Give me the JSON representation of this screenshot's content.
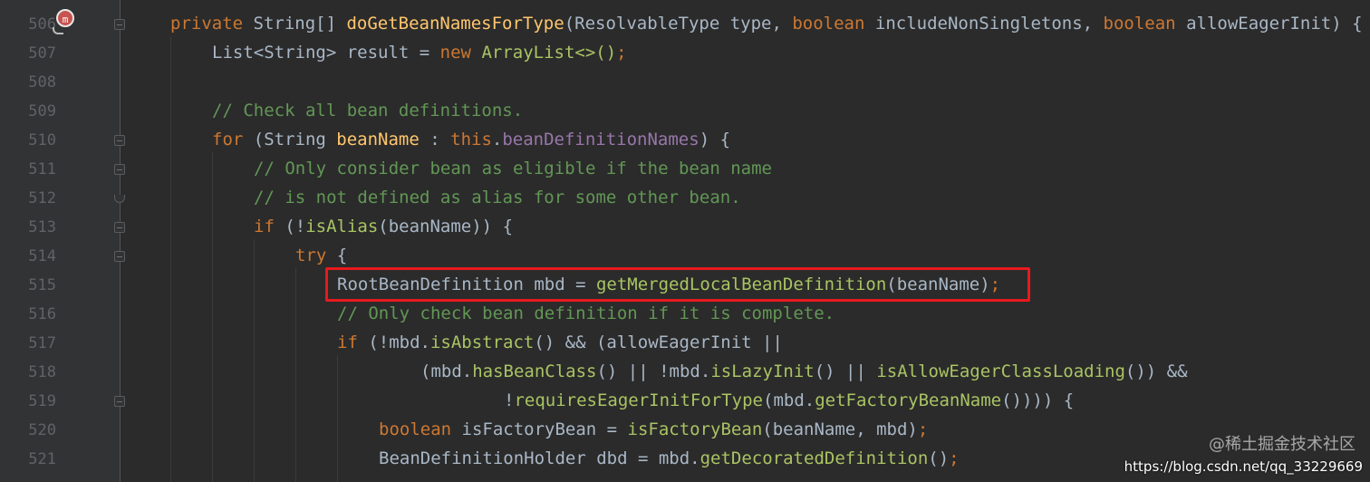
{
  "editor": {
    "lines": [
      {
        "num": "506"
      },
      {
        "num": "507"
      },
      {
        "num": "508"
      },
      {
        "num": "509"
      },
      {
        "num": "510"
      },
      {
        "num": "511"
      },
      {
        "num": "512"
      },
      {
        "num": "513"
      },
      {
        "num": "514"
      },
      {
        "num": "515"
      },
      {
        "num": "516"
      },
      {
        "num": "517"
      },
      {
        "num": "518"
      },
      {
        "num": "519"
      },
      {
        "num": "520"
      },
      {
        "num": "521"
      }
    ],
    "code": {
      "l506": [
        {
          "t": "private ",
          "c": "kw"
        },
        {
          "t": "String[] ",
          "c": "pl"
        },
        {
          "t": "doGetBeanNamesForType",
          "c": "fn"
        },
        {
          "t": "(ResolvableType type, ",
          "c": "pl"
        },
        {
          "t": "boolean ",
          "c": "kw"
        },
        {
          "t": "includeNonSingletons, ",
          "c": "pl"
        },
        {
          "t": "boolean ",
          "c": "kw"
        },
        {
          "t": "allowEagerInit) {",
          "c": "pl"
        }
      ],
      "l507": [
        {
          "t": "List<String> result = ",
          "c": "pl"
        },
        {
          "t": "new ",
          "c": "kw"
        },
        {
          "t": "ArrayList<>()",
          "c": "mc"
        },
        {
          "t": ";",
          "c": "kw"
        }
      ],
      "l508": [],
      "l509": [
        {
          "t": "// Check all bean definitions.",
          "c": "cm"
        }
      ],
      "l510": [
        {
          "t": "for ",
          "c": "kw"
        },
        {
          "t": "(String ",
          "c": "pl"
        },
        {
          "t": "beanName ",
          "c": "fn"
        },
        {
          "t": ": ",
          "c": "pl"
        },
        {
          "t": "this",
          "c": "kw"
        },
        {
          "t": ".",
          "c": "pl"
        },
        {
          "t": "beanDefinitionNames",
          "c": "fld"
        },
        {
          "t": ") {",
          "c": "pl"
        }
      ],
      "l511": [
        {
          "t": "// Only consider bean as eligible if the bean name",
          "c": "cm"
        }
      ],
      "l512": [
        {
          "t": "// is not defined as alias for some other bean.",
          "c": "cm"
        }
      ],
      "l513": [
        {
          "t": "if ",
          "c": "kw"
        },
        {
          "t": "(!",
          "c": "pl"
        },
        {
          "t": "isAlias",
          "c": "mc"
        },
        {
          "t": "(beanName)) {",
          "c": "pl"
        }
      ],
      "l514": [
        {
          "t": "try ",
          "c": "kw"
        },
        {
          "t": "{",
          "c": "pl"
        }
      ],
      "l515": [
        {
          "t": "RootBeanDefinition mbd = ",
          "c": "pl"
        },
        {
          "t": "getMergedLocalBeanDefinition",
          "c": "mc"
        },
        {
          "t": "(beanName)",
          "c": "pl"
        },
        {
          "t": ";",
          "c": "kw"
        }
      ],
      "l516": [
        {
          "t": "// Only check bean definition if it is complete.",
          "c": "cm"
        }
      ],
      "l517": [
        {
          "t": "if ",
          "c": "kw"
        },
        {
          "t": "(!mbd.",
          "c": "pl"
        },
        {
          "t": "isAbstract",
          "c": "mc"
        },
        {
          "t": "() && (allowEagerInit ||",
          "c": "pl"
        }
      ],
      "l518": [
        {
          "t": "(mbd.",
          "c": "pl"
        },
        {
          "t": "hasBeanClass",
          "c": "mc"
        },
        {
          "t": "() || !mbd.",
          "c": "pl"
        },
        {
          "t": "isLazyInit",
          "c": "mc"
        },
        {
          "t": "() || ",
          "c": "pl"
        },
        {
          "t": "isAllowEagerClassLoading",
          "c": "mc"
        },
        {
          "t": "()) &&",
          "c": "pl"
        }
      ],
      "l519": [
        {
          "t": "!",
          "c": "pl"
        },
        {
          "t": "requiresEagerInitForType",
          "c": "mc"
        },
        {
          "t": "(mbd.",
          "c": "pl"
        },
        {
          "t": "getFactoryBeanName",
          "c": "mc"
        },
        {
          "t": "()))) {",
          "c": "pl"
        }
      ],
      "l520": [
        {
          "t": "boolean ",
          "c": "kw"
        },
        {
          "t": "isFactoryBean = ",
          "c": "pl"
        },
        {
          "t": "isFactoryBean",
          "c": "mc"
        },
        {
          "t": "(beanName, mbd)",
          "c": "pl"
        },
        {
          "t": ";",
          "c": "kw"
        }
      ],
      "l521": [
        {
          "t": "BeanDefinitionHolder dbd = mbd.",
          "c": "pl"
        },
        {
          "t": "getDecoratedDefinition",
          "c": "mc"
        },
        {
          "t": "()",
          "c": "pl"
        },
        {
          "t": ";",
          "c": "kw"
        }
      ]
    }
  },
  "gutter": {
    "breakpoint_icon_label": "m"
  },
  "watermark": {
    "brand": "@稀土掘金技术社区",
    "url": "https://blog.csdn.net/qq_33229669"
  },
  "colors": {
    "background": "#2b2b2b",
    "gutter": "#313335",
    "keyword": "#cc7832",
    "method_decl": "#ffc66d",
    "method_call": "#a9c463",
    "field": "#9876aa",
    "comment": "#629755",
    "plain": "#a9b7c6",
    "highlight_box": "#e8191d"
  }
}
